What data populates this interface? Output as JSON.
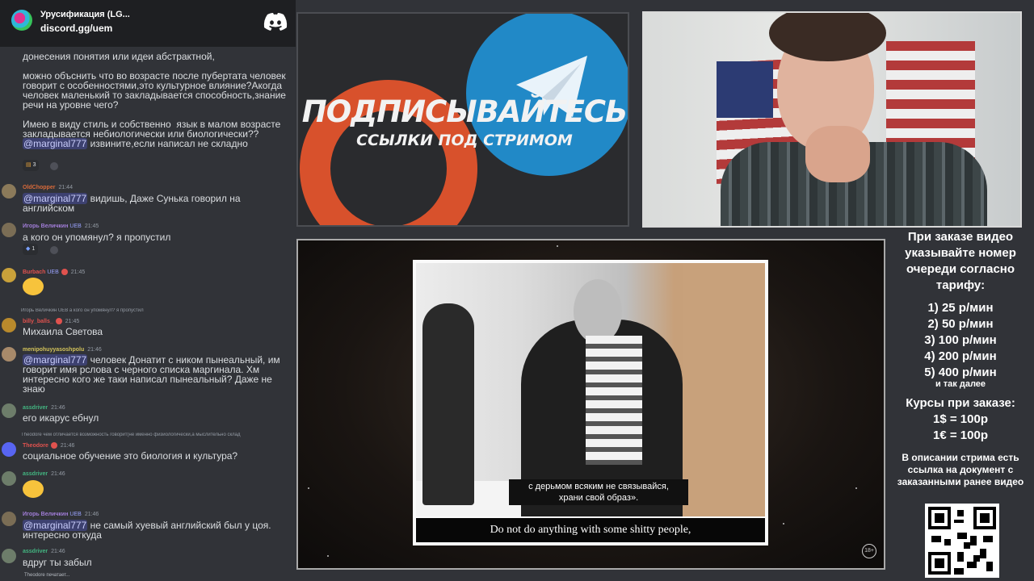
{
  "chat": {
    "server_name": "Урусификация (LG...",
    "invite_link": "discord.gg/uem",
    "typing_indicator": "Theodore печатает...",
    "messages": [
      {
        "text": "донесения понятия или идеи абстрактной,"
      },
      {
        "text": "можно объснить что во возрасте после пубертата человек говорит с особенностями,это культурное влияние?Акогда человек маленький то закладывается способность,знание речи на уровне чего?"
      },
      {
        "text_before": "Имею в виду стиль и собственно  язык в малом возрасте закладывается небиологически или биологически??",
        "mention": "@marginal777",
        "text_after": " извините,если написал не складно"
      },
      {
        "reaction_count": "3"
      },
      {
        "author": "OldChopper",
        "time": "21:44",
        "mention": "@marginal777",
        "text_after": " видишь, Даже Сунька говорил на английском"
      },
      {
        "author": "Игорь Величкин",
        "badge": "UEB",
        "time": "21:45",
        "text": "а кого он упомянул? я пропустил"
      },
      {
        "reaction_count": "1"
      },
      {
        "author": "Burbach",
        "badge": "UEB",
        "time": "21:45"
      },
      {
        "reply_preview": "Игорь Величкин UEB а кого он упомянул? я пропустил"
      },
      {
        "author": "billy_balls_",
        "time": "21:45",
        "text": "Михаила Светова"
      },
      {
        "author": "menipohuyyasoshpolu",
        "time": "21:46",
        "mention": "@marginal777",
        "text_after": " человек Донатит с ником пынеальный, им говорит имя рслова с черного списка маргинала. Хм интересно кого же таки написал пынеальный? Даже не знаю"
      },
      {
        "author": "assdriver",
        "time": "21:46",
        "text": "его икарус ебнул"
      },
      {
        "reply_preview": "Theodore чем отличается возможность говорит(не именно физиологически,а мыслительно склад"
      },
      {
        "author": "Theodore",
        "time": "21:46",
        "text": "социальное обучение это биология и культура?"
      },
      {
        "author": "assdriver",
        "time": "21:46"
      },
      {
        "author": "Игорь Величкин",
        "badge": "UEB",
        "time": "21:46",
        "mention": "@marginal777",
        "text_after": " не самый хуевый английский был у цоя. интересно откуда"
      },
      {
        "author": "assdriver",
        "time": "21:46",
        "text": "вдруг ты забыл"
      }
    ]
  },
  "banner": {
    "title": "ПОДПИСЫВАЙТЕСЬ",
    "subtitle": "ССЫЛКИ ПОД СТРИМОМ"
  },
  "video": {
    "subtitle_ru": "с дерьмом всяким не связывайся,\nхрани свой образ».",
    "subtitle_en": "Do not do anything with some shitty people,",
    "age_rating": "18+"
  },
  "info_panel": {
    "heading": "При заказе видео указывайте номер очереди согласно тарифу:",
    "tariffs": [
      "1) 25 р/мин",
      "2) 50 р/мин",
      "3) 100 р/мин",
      "4) 200 р/мин",
      "5) 400 р/мин"
    ],
    "tariffs_more": "и так далее",
    "rates_title": "Курсы при заказе:",
    "rates": [
      "1$ = 100р",
      "1€ = 100р"
    ],
    "description_note": "В описании стрима есть ссылка на документ с заказанными ранее видео"
  },
  "colors": {
    "discord_bg": "#313338",
    "mention_bg": "#3c4270",
    "patreon": "#d8512c",
    "telegram": "#2189c7"
  }
}
